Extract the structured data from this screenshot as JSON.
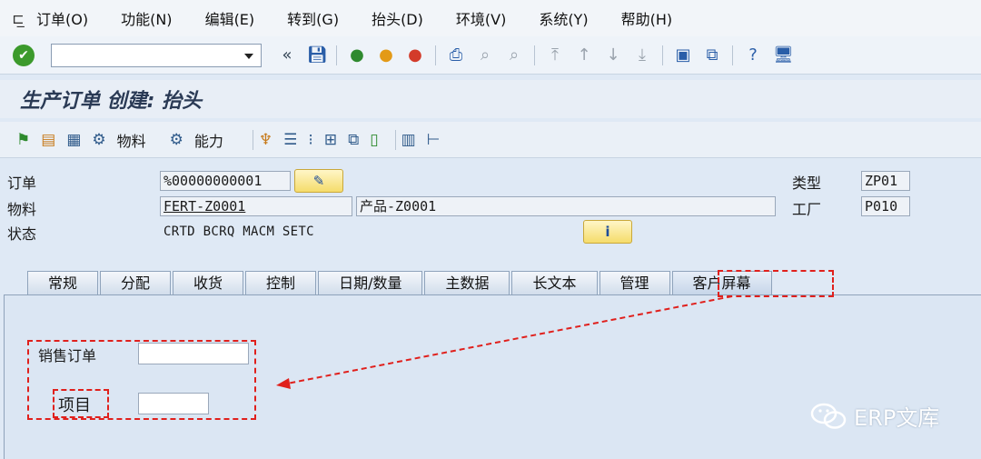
{
  "menu": {
    "items": [
      "订单(O)",
      "功能(N)",
      "编辑(E)",
      "转到(G)",
      "抬头(D)",
      "环境(V)",
      "系统(Y)",
      "帮助(H)"
    ]
  },
  "toolbar": {
    "command_value": "",
    "back_arrows": "«"
  },
  "page_title": "生产订单 创建: 抬头",
  "app_toolbar": {
    "material_label": "物料",
    "capacity_label": "能力"
  },
  "header": {
    "order_label": "订单",
    "order_value": "%00000000001",
    "material_label": "物料",
    "material_value": "FERT-Z0001",
    "material_desc": "产品-Z0001",
    "status_label": "状态",
    "status_value": "CRTD BCRQ MACM SETC",
    "type_label": "类型",
    "type_value": "ZP01",
    "plant_label": "工厂",
    "plant_value": "P010",
    "info_icon": "i"
  },
  "tabs": [
    "常规",
    "分配",
    "收货",
    "控制",
    "日期/数量",
    "主数据",
    "长文本",
    "管理",
    "客户屏幕"
  ],
  "customer_screen": {
    "sales_order_label": "销售订单",
    "sales_order_value": "",
    "item_label": "项目",
    "item_value": ""
  },
  "watermark": {
    "text": "ERP文库"
  },
  "colors": {
    "annotation_red": "#e0201c",
    "background": "#dfe9f5"
  }
}
